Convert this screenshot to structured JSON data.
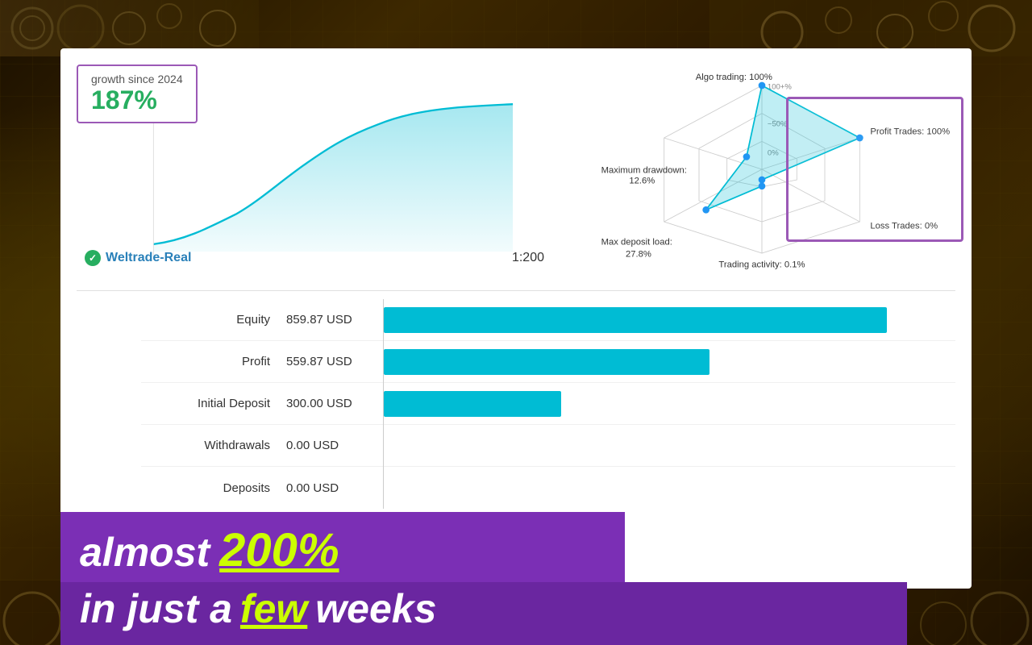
{
  "background": {
    "color": "#2a1500"
  },
  "card": {
    "growth_badge": {
      "since_label": "growth since 2024",
      "percent": "187%"
    },
    "account": {
      "name": "Weltrade-Real",
      "leverage": "1:200"
    },
    "radar": {
      "labels": {
        "algo_trading": "Algo trading: 100%",
        "profit_trades": "Profit Trades: 100%",
        "loss_trades": "Loss Trades: 0%",
        "trading_activity": "Trading activity: 0.1%",
        "max_deposit_load": "Max deposit load:",
        "max_deposit_load2": "27.8%",
        "maximum_drawdown": "Maximum drawdown:",
        "maximum_drawdown2": "12.6%"
      },
      "grid_labels": {
        "outer": "100+%",
        "mid": "~50%",
        "inner": "0%"
      }
    },
    "stats": [
      {
        "label": "Equity",
        "value": "859.87 USD",
        "bar_pct": 85
      },
      {
        "label": "Profit",
        "value": "559.87 USD",
        "bar_pct": 55
      },
      {
        "label": "Initial Deposit",
        "value": "300.00 USD",
        "bar_pct": 30
      },
      {
        "label": "Withdrawals",
        "value": "0.00 USD",
        "bar_pct": 0
      },
      {
        "label": "Deposits",
        "value": "0.00 USD",
        "bar_pct": 0
      }
    ]
  },
  "banner": {
    "line1_pre": "almost ",
    "line1_highlight": "200%",
    "line2_pre": "in just a ",
    "line2_highlight": "few",
    "line2_post": " weeks"
  }
}
